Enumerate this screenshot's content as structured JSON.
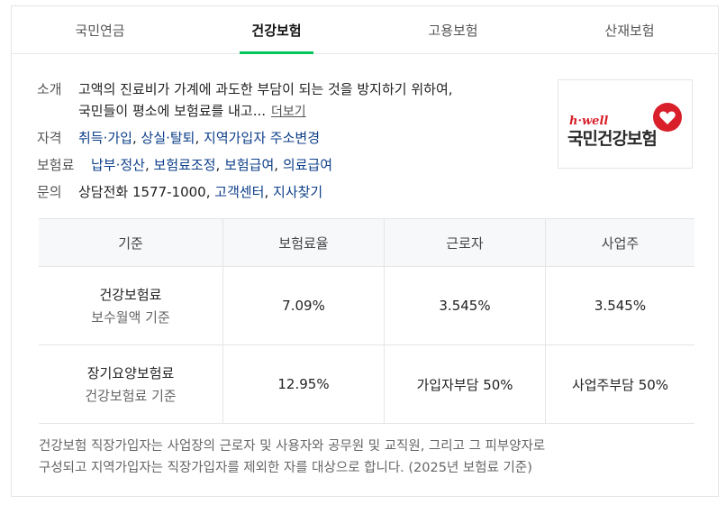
{
  "tabs": [
    {
      "label": "국민연금",
      "active": false
    },
    {
      "label": "건강보험",
      "active": true
    },
    {
      "label": "고용보험",
      "active": false
    },
    {
      "label": "산재보험",
      "active": false
    }
  ],
  "intro": {
    "label": "소개",
    "line1": "고액의 진료비가 가계에 과도한 부담이 되는 것을 방지하기 위하여,",
    "line2": "국민들이 평소에 보험료를 내고...",
    "more": "더보기"
  },
  "eligibility": {
    "label": "자격",
    "links": [
      "취득·가입",
      "상실·탈퇴",
      "지역가입자 주소변경"
    ]
  },
  "premium": {
    "label": "보험료",
    "links": [
      "납부·정산",
      "보험료조정",
      "보험급여",
      "의료급여"
    ]
  },
  "contact": {
    "label": "문의",
    "phone": "상담전화 1577-1000,",
    "links": [
      "고객센터",
      "지사찾기"
    ]
  },
  "logo": {
    "sub": "h·well",
    "main": "국민건강보험"
  },
  "table": {
    "headers": [
      "기준",
      "보험료율",
      "근로자",
      "사업주"
    ],
    "rows": [
      {
        "name": "건강보험료",
        "sub": "보수월액 기준",
        "rate": "7.09%",
        "employee": "3.545%",
        "employer": "3.545%"
      },
      {
        "name": "장기요양보험료",
        "sub": "건강보험료 기준",
        "rate": "12.95%",
        "employee": "가입자부담 50%",
        "employer": "사업주부담 50%"
      }
    ]
  },
  "note": {
    "line1": "건강보험 직장가입자는 사업장의 근로자 및 사용자와 공무원 및 교직원, 그리고 그 피부양자로",
    "line2": "구성되고 지역가입자는 직장가입자를 제외한 자를 대상으로 합니다. (2025년 보험료 기준)"
  },
  "colors": {
    "accent": "#03c75a",
    "link": "#0d3f8a",
    "logo_red": "#d81f2a"
  }
}
